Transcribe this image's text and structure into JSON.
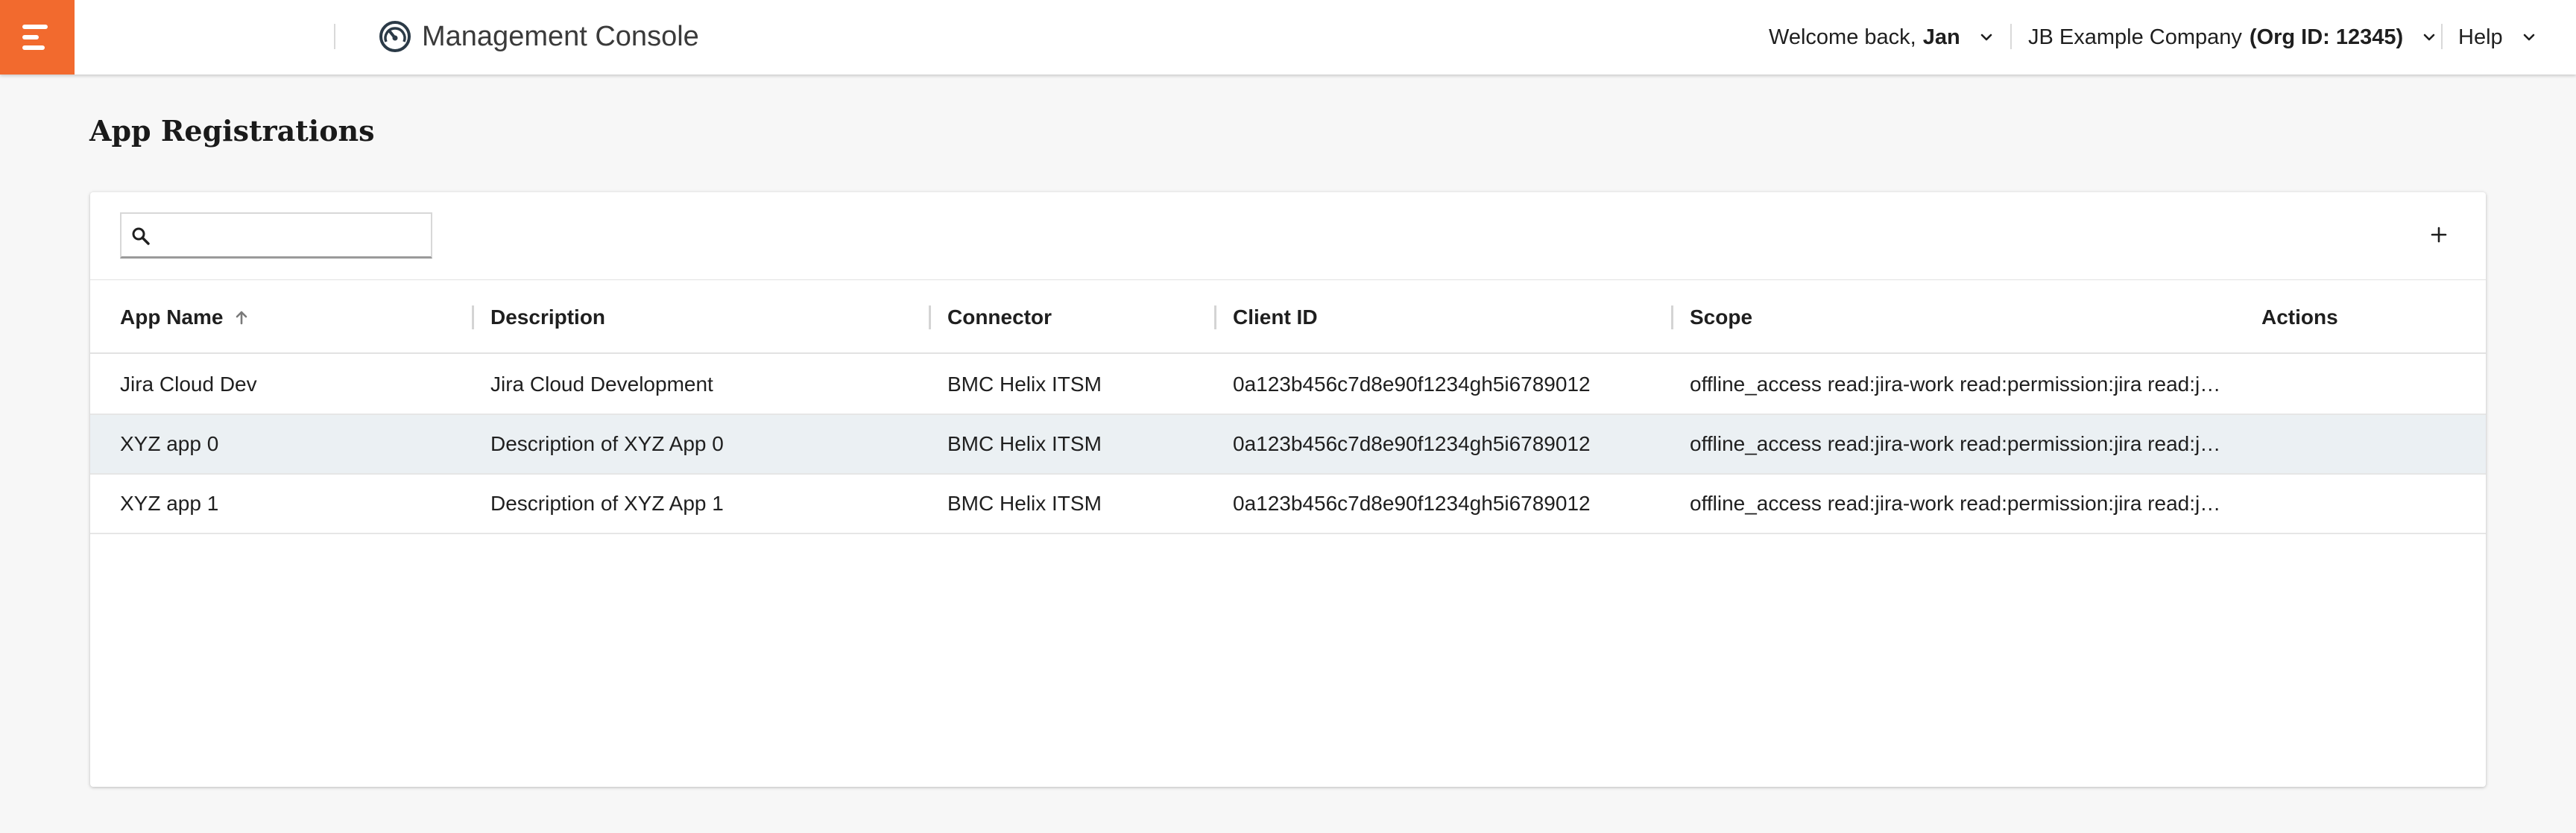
{
  "header": {
    "app_title": "Management Console",
    "welcome_prefix": "Welcome back,",
    "user_name": "Jan",
    "company_name": "JB Example Company",
    "org_label": "(Org ID: 12345)",
    "help_label": "Help"
  },
  "page": {
    "title": "App Registrations"
  },
  "search": {
    "placeholder": "",
    "value": ""
  },
  "table": {
    "columns": [
      {
        "label": "App Name",
        "sorted": "ascending"
      },
      {
        "label": "Description"
      },
      {
        "label": "Connector"
      },
      {
        "label": "Client ID"
      },
      {
        "label": "Scope"
      },
      {
        "label": "Actions"
      }
    ],
    "rows": [
      {
        "app_name": "Jira Cloud Dev",
        "description": "Jira Cloud Development",
        "connector": "BMC Helix ITSM",
        "client_id": "0a123b456c7d8e90f1234gh5i6789012",
        "scope": "offline_access read:jira-work read:permission:jira read:jira-user",
        "selected": false
      },
      {
        "app_name": "XYZ app 0",
        "description": "Description of XYZ App 0",
        "connector": "BMC Helix ITSM",
        "client_id": "0a123b456c7d8e90f1234gh5i6789012",
        "scope": "offline_access read:jira-work read:permission:jira read:jira-user",
        "selected": true
      },
      {
        "app_name": "XYZ app 1",
        "description": "Description of XYZ App 1",
        "connector": "BMC Helix ITSM",
        "client_id": "0a123b456c7d8e90f1234gh5i6789012",
        "scope": "offline_access read:jira-work read:permission:jira read:jira-user",
        "selected": false
      }
    ]
  },
  "icons": {
    "menu": "menu-icon",
    "brand": "gauge-icon",
    "chevron": "chevron-down-icon",
    "search": "search-icon",
    "add": "plus-icon",
    "sort": "arrow-up-icon"
  },
  "colors": {
    "accent": "#f26a2e",
    "selected_row": "#ebf0f3",
    "brand_icon": "#2b3a47"
  }
}
